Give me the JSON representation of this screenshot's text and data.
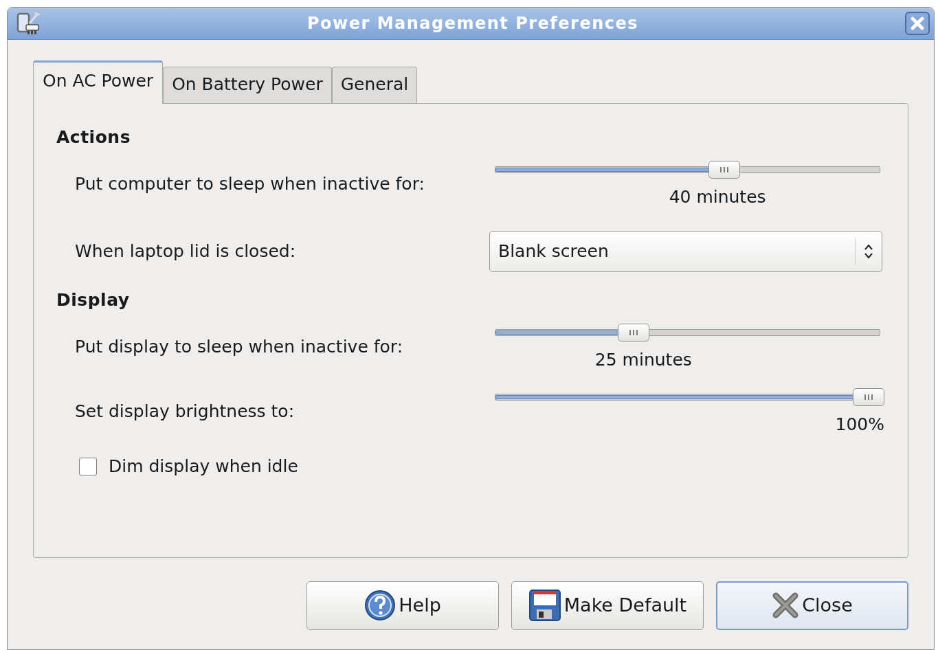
{
  "window": {
    "title": "Power Management Preferences"
  },
  "tabs": [
    {
      "label": "On AC Power",
      "selected": true
    },
    {
      "label": "On Battery Power",
      "selected": false
    },
    {
      "label": "General",
      "selected": false
    }
  ],
  "sections": [
    {
      "heading": "Actions",
      "rows": [
        {
          "kind": "slider",
          "label": "Put computer to sleep when inactive for:",
          "level": 0.6,
          "reading": "40 minutes"
        },
        {
          "kind": "combo",
          "label": "When laptop lid is closed:",
          "value": "Blank screen"
        }
      ]
    },
    {
      "heading": "Display",
      "rows": [
        {
          "kind": "slider",
          "label": "Put display to sleep when inactive for:",
          "level": 0.35,
          "reading": "25 minutes"
        },
        {
          "kind": "slider",
          "label": "Set display brightness to:",
          "level": 1.0,
          "reading": "100%"
        },
        {
          "kind": "checkbox",
          "label": "Dim display when idle",
          "checked": false
        }
      ]
    }
  ],
  "buttons": [
    {
      "kind": "help",
      "label": "Help",
      "focused": false
    },
    {
      "kind": "save",
      "label": "Make Default",
      "focused": false
    },
    {
      "kind": "close",
      "label": "Close",
      "focused": true
    }
  ]
}
